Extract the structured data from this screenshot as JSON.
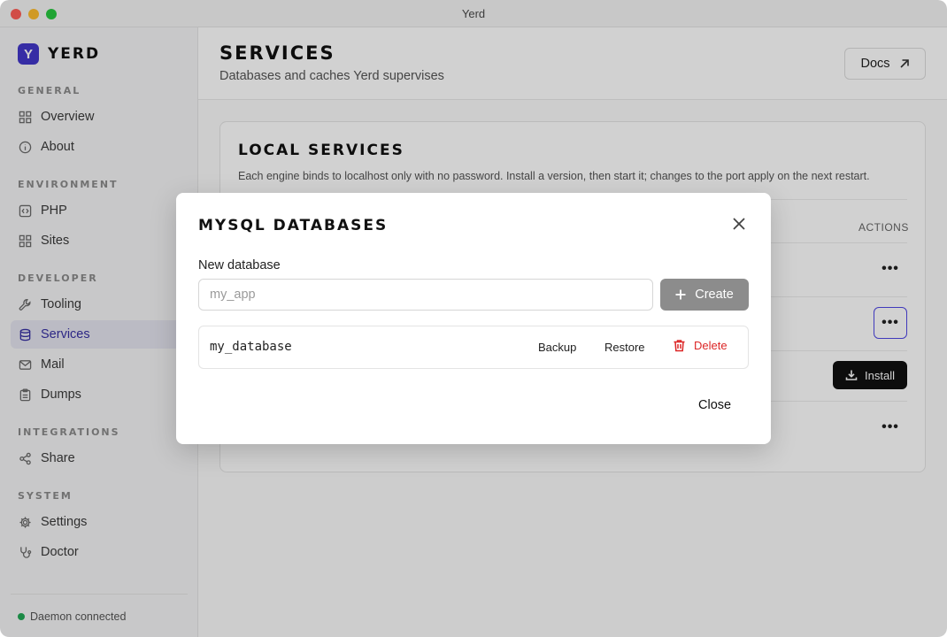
{
  "window": {
    "title": "Yerd"
  },
  "brand": {
    "logo_letter": "Y",
    "name": "YERD"
  },
  "sidebar": {
    "sections": {
      "general": "GENERAL",
      "environment": "ENVIRONMENT",
      "developer": "DEVELOPER",
      "integrations": "INTEGRATIONS",
      "system": "SYSTEM"
    },
    "items": {
      "overview": {
        "label": "Overview",
        "icon": "grid-icon"
      },
      "about": {
        "label": "About",
        "icon": "info-icon"
      },
      "php": {
        "label": "PHP",
        "icon": "code-icon"
      },
      "sites": {
        "label": "Sites",
        "icon": "grid-icon"
      },
      "tooling": {
        "label": "Tooling",
        "icon": "wrench-icon"
      },
      "services": {
        "label": "Services",
        "icon": "database-icon",
        "active": true
      },
      "mail": {
        "label": "Mail",
        "icon": "mail-icon"
      },
      "dumps": {
        "label": "Dumps",
        "icon": "clipboard-icon"
      },
      "share": {
        "label": "Share",
        "icon": "share-icon"
      },
      "settings": {
        "label": "Settings",
        "icon": "gear-icon"
      },
      "doctor": {
        "label": "Doctor",
        "icon": "stethoscope-icon"
      }
    },
    "status": "Daemon connected",
    "status_color": "#22a855"
  },
  "header": {
    "title": "SERVICES",
    "subtitle": "Databases and caches Yerd supervises",
    "docs_label": "Docs"
  },
  "card": {
    "title": "LOCAL SERVICES",
    "description": "Each engine binds to localhost only with no password. Install a version, then start it; changes to the port apply on the next restart.",
    "actions_header": "ACTIONS",
    "more_label": "•••",
    "install_label": "Install"
  },
  "modal": {
    "title": "MYSQL DATABASES",
    "new_label": "New database",
    "input_placeholder": "my_app",
    "input_value": "",
    "create_label": "Create",
    "databases": [
      {
        "name": "my_database",
        "backup": "Backup",
        "restore": "Restore",
        "delete": "Delete"
      }
    ],
    "close_label": "Close"
  },
  "colors": {
    "accent": "#4338ca",
    "danger": "#dc2626",
    "primary_dark": "#111111"
  }
}
